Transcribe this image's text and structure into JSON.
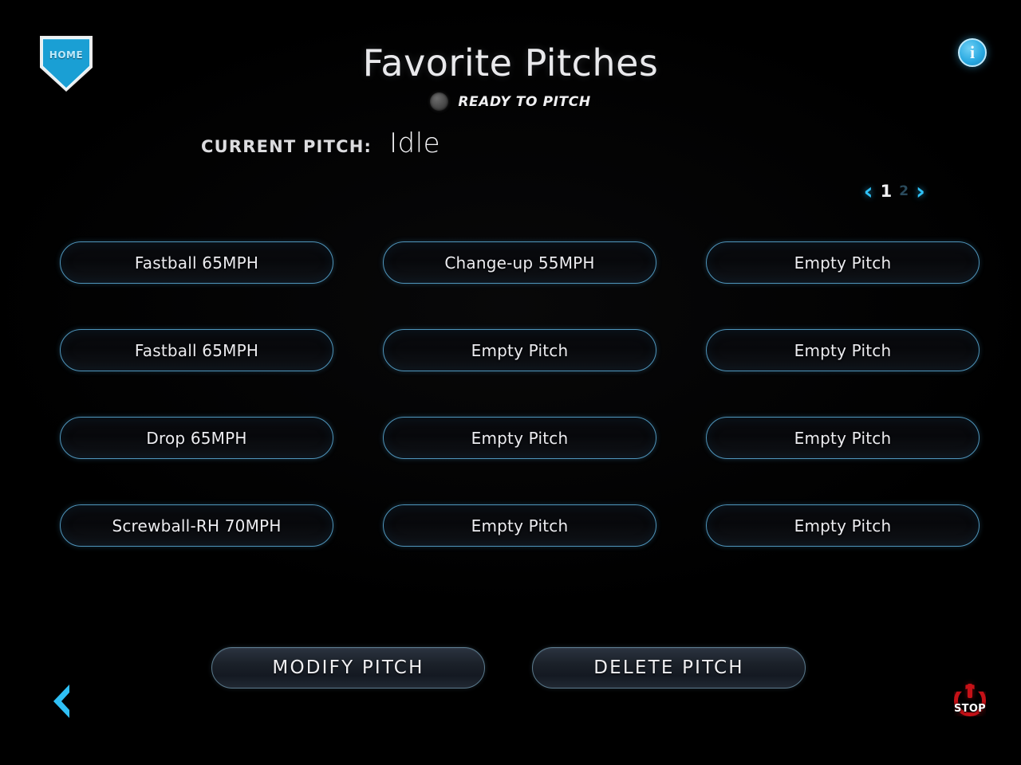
{
  "header": {
    "title": "Favorite Pitches",
    "status_text": "READY TO PITCH",
    "home_label": "HOME",
    "info_glyph": "i"
  },
  "current_pitch": {
    "label": "CURRENT PITCH:",
    "value": "Idle"
  },
  "pager": {
    "prev_glyph": "‹",
    "next_glyph": "›",
    "pages": [
      "1",
      "2"
    ],
    "active_page": "1"
  },
  "pitches": [
    {
      "label": "Fastball 65MPH"
    },
    {
      "label": "Change-up 55MPH"
    },
    {
      "label": "Empty Pitch"
    },
    {
      "label": "Fastball 65MPH"
    },
    {
      "label": "Empty Pitch"
    },
    {
      "label": "Empty Pitch"
    },
    {
      "label": "Drop 65MPH"
    },
    {
      "label": "Empty Pitch"
    },
    {
      "label": "Empty Pitch"
    },
    {
      "label": "Screwball-RH 70MPH"
    },
    {
      "label": "Empty Pitch"
    },
    {
      "label": "Empty Pitch"
    }
  ],
  "actions": {
    "modify_label": "MODIFY PITCH",
    "delete_label": "DELETE PITCH"
  },
  "footer": {
    "stop_label": "STOP"
  },
  "colors": {
    "accent_cyan": "#2fc0f5",
    "button_border": "#4f95bb",
    "stop_red": "#c51117",
    "background": "#000000",
    "text": "#ececf0"
  }
}
